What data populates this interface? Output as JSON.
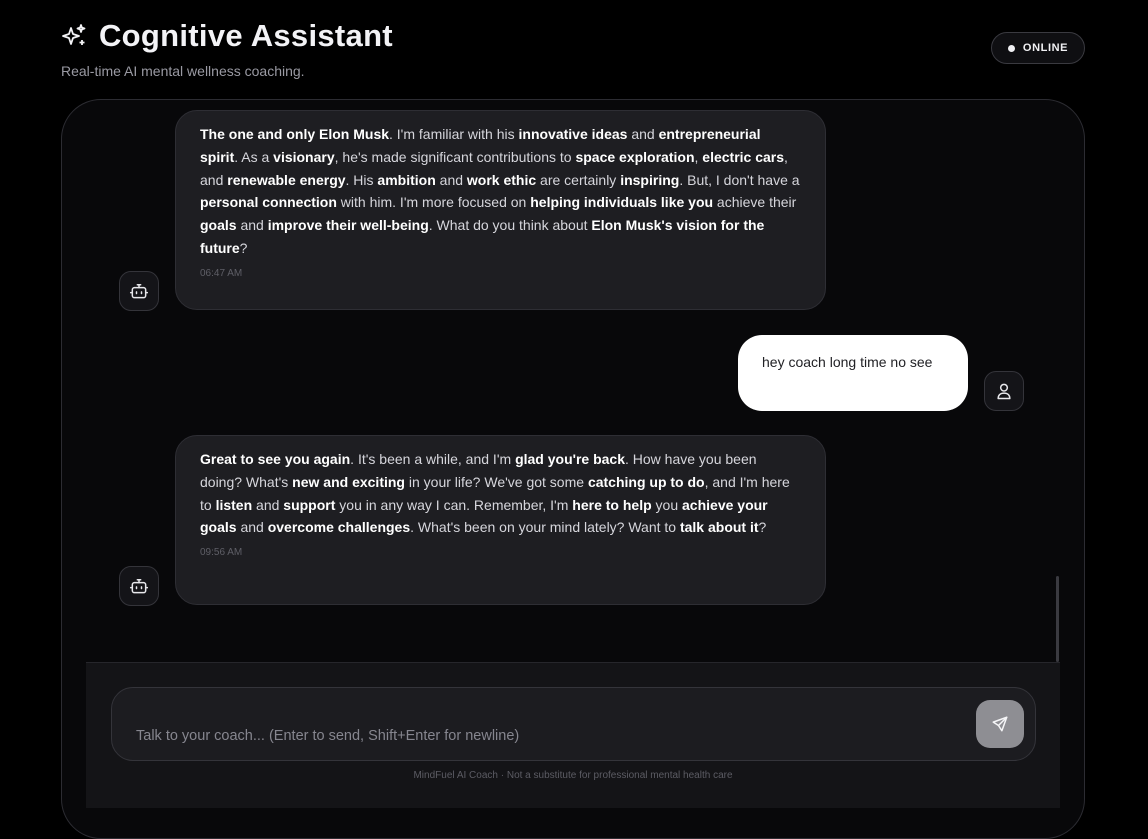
{
  "header": {
    "title": "Cognitive Assistant",
    "subtitle": "Real-time AI mental wellness coaching.",
    "icon": "sparkles-icon"
  },
  "status": {
    "label": "ONLINE"
  },
  "messages": [
    {
      "role": "assistant",
      "segments": [
        {
          "t": "The one and only Elon Musk",
          "b": true
        },
        {
          "t": ". I'm familiar with his "
        },
        {
          "t": "innovative ideas",
          "b": true
        },
        {
          "t": " and "
        },
        {
          "t": "entrepreneurial spirit",
          "b": true
        },
        {
          "t": ". As a "
        },
        {
          "t": "visionary",
          "b": true
        },
        {
          "t": ", he's made significant contributions to "
        },
        {
          "t": "space exploration",
          "b": true
        },
        {
          "t": ", "
        },
        {
          "t": "electric cars",
          "b": true
        },
        {
          "t": ", and "
        },
        {
          "t": "renewable energy",
          "b": true
        },
        {
          "t": ". His "
        },
        {
          "t": "ambition",
          "b": true
        },
        {
          "t": " and "
        },
        {
          "t": "work ethic",
          "b": true
        },
        {
          "t": " are certainly "
        },
        {
          "t": "inspiring",
          "b": true
        },
        {
          "t": ". But, I don't have a "
        },
        {
          "t": "personal connection",
          "b": true
        },
        {
          "t": " with him. I'm more focused on "
        },
        {
          "t": "helping individuals like you",
          "b": true
        },
        {
          "t": " achieve their "
        },
        {
          "t": "goals",
          "b": true
        },
        {
          "t": " and "
        },
        {
          "t": "improve their well-being",
          "b": true
        },
        {
          "t": ". What do you think about "
        },
        {
          "t": "Elon Musk's vision for the future",
          "b": true
        },
        {
          "t": "?"
        }
      ],
      "time": "06:47 AM"
    },
    {
      "role": "user",
      "text": "hey coach long time no see"
    },
    {
      "role": "assistant",
      "segments": [
        {
          "t": "Great to see you again",
          "b": true
        },
        {
          "t": ". It's been a while, and I'm "
        },
        {
          "t": "glad you're back",
          "b": true
        },
        {
          "t": ". How have you been doing? What's "
        },
        {
          "t": "new and exciting",
          "b": true
        },
        {
          "t": " in your life? We've got some "
        },
        {
          "t": "catching up to do",
          "b": true
        },
        {
          "t": ", and I'm here to "
        },
        {
          "t": "listen",
          "b": true
        },
        {
          "t": " and "
        },
        {
          "t": "support",
          "b": true
        },
        {
          "t": " you in any way I can. Remember, I'm "
        },
        {
          "t": "here to help",
          "b": true
        },
        {
          "t": " you "
        },
        {
          "t": "achieve your goals",
          "b": true
        },
        {
          "t": " and "
        },
        {
          "t": "overcome challenges",
          "b": true
        },
        {
          "t": ". What's been on your mind lately? Want to "
        },
        {
          "t": "talk about it",
          "b": true
        },
        {
          "t": "?"
        }
      ],
      "time": "09:56 AM"
    }
  ],
  "composer": {
    "placeholder": "Talk to your coach... (Enter to send, Shift+Enter for newline)",
    "value": "",
    "send_icon": "send-icon"
  },
  "footer": {
    "disclaimer": "MindFuel AI Coach · Not a substitute for professional mental health care"
  },
  "colors": {
    "background": "#000000",
    "panel": "#08080a",
    "bot_bubble": "#1e1e22",
    "user_bubble": "#ffffff",
    "send_button": "#8e8e93"
  }
}
